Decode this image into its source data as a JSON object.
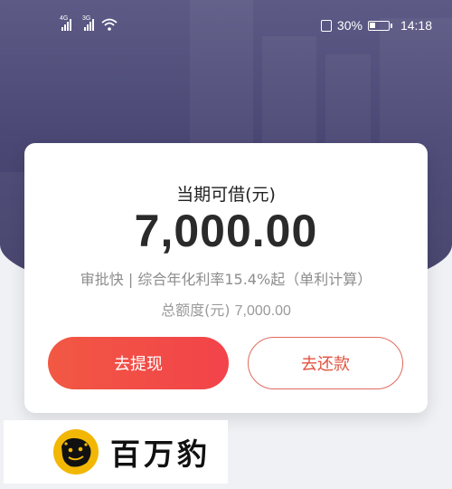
{
  "status_bar": {
    "signal1_label": "4G",
    "signal2_label": "3G",
    "battery": "30%",
    "battery_level": 0.3,
    "time": "14:18"
  },
  "loan_card": {
    "title": "当期可借(元)",
    "amount": "7,000.00",
    "description": "审批快 | 综合年化利率15.4%起（单利计算）",
    "total_label": "总额度(元)",
    "total_value": "7,000.00",
    "withdraw_button": "去提现",
    "repay_button": "去还款"
  },
  "brand": {
    "name": "百万豹"
  },
  "colors": {
    "header_bg": "#4b4875",
    "primary_button": "#f24a45",
    "secondary_border": "#e06a5e"
  }
}
